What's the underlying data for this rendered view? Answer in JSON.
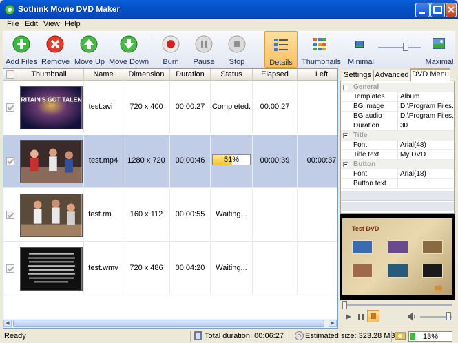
{
  "window": {
    "title": "Sothink Movie DVD Maker"
  },
  "menu": [
    "File",
    "Edit",
    "View",
    "Help"
  ],
  "toolbar": {
    "add_files": "Add Files",
    "remove": "Remove",
    "move_up": "Move Up",
    "move_down": "Move Down",
    "burn": "Burn",
    "pause": "Pause",
    "stop": "Stop",
    "details": "Details",
    "thumbnails": "Thumbnails",
    "minimal": "Minimal",
    "maximal": "Maximal",
    "zoom_level": 0.65
  },
  "table": {
    "columns": [
      "Thumbnail",
      "Name",
      "Dimension",
      "Duration",
      "Status",
      "Elapsed",
      "Left"
    ],
    "rows": [
      {
        "name": "test.avi",
        "dimension": "720 x 400",
        "duration": "00:00:27",
        "status": "Completed.",
        "elapsed": "00:00:27",
        "left": "",
        "thumb_text": "BRITAIN'S GOT TALENT"
      },
      {
        "name": "test.mp4",
        "dimension": "1280 x 720",
        "duration": "00:00:46",
        "status": "51%",
        "progress": 0.51,
        "elapsed": "00:00:39",
        "left": "00:00:37"
      },
      {
        "name": "test.rm",
        "dimension": "160 x 112",
        "duration": "00:00:55",
        "status": "Waiting...",
        "elapsed": "",
        "left": ""
      },
      {
        "name": "test.wmv",
        "dimension": "720 x 486",
        "duration": "00:04:20",
        "status": "Waiting...",
        "elapsed": "",
        "left": ""
      }
    ]
  },
  "panel": {
    "tabs": [
      "Settings",
      "Advanced",
      "DVD Menu"
    ],
    "active_tab": "DVD Menu",
    "categories": {
      "general": "General",
      "title": "Title",
      "button": "Button"
    },
    "general": [
      {
        "k": "Templates",
        "v": "Album"
      },
      {
        "k": "BG image",
        "v": "D:\\Program Files..."
      },
      {
        "k": "BG audio",
        "v": "D:\\Program Files..."
      },
      {
        "k": "Duration",
        "v": "30"
      }
    ],
    "title": [
      {
        "k": "Font",
        "v": "Arial(48)"
      },
      {
        "k": "Title text",
        "v": "My DVD"
      }
    ],
    "button": [
      {
        "k": "Font",
        "v": "Arial(18)"
      },
      {
        "k": "Button text",
        "v": ""
      }
    ],
    "preview_title": "Test DVD"
  },
  "status": {
    "ready": "Ready",
    "total_duration": "Total duration: 00:06:27",
    "estimated_size": "Estimated size: 323.28 MB",
    "disc_usage": "13%",
    "disc_fraction": 0.13
  },
  "colors": {
    "titlebar": "#0a5fd8",
    "selected_row": "#c1cde6",
    "progress": "#f4c430",
    "accent_tab": "#f0a030"
  }
}
